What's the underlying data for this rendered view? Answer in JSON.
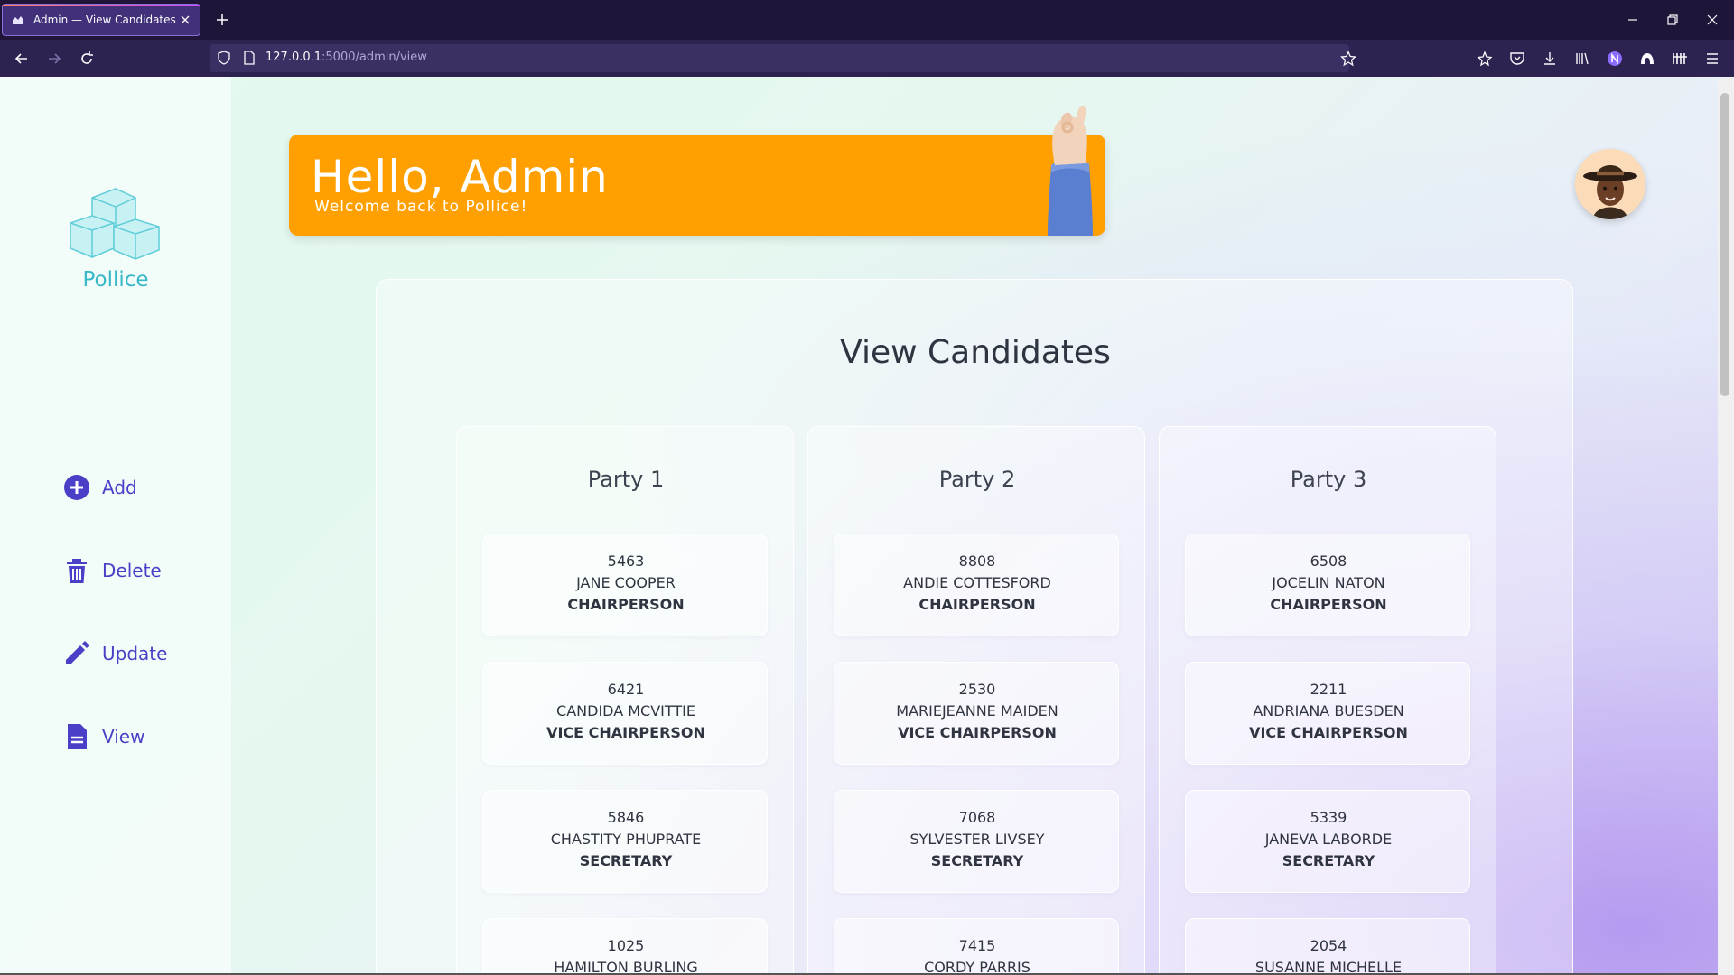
{
  "browser": {
    "tab_title": "Admin — View Candidates",
    "url_host": "127.0.0.1",
    "url_rest": ":5000/admin/view"
  },
  "sidebar": {
    "logo_text": "Pollice",
    "items": [
      {
        "label": "Add",
        "icon": "plus-circle-icon"
      },
      {
        "label": "Delete",
        "icon": "trash-icon"
      },
      {
        "label": "Update",
        "icon": "pencil-icon"
      },
      {
        "label": "View",
        "icon": "document-icon"
      }
    ]
  },
  "banner": {
    "title": "Hello, Admin",
    "subtitle": "Welcome back to Pollice!",
    "color": "#ffa000"
  },
  "main": {
    "title": "View Candidates",
    "parties": [
      {
        "name": "Party 1",
        "candidates": [
          {
            "id": "5463",
            "name": "JANE COOPER",
            "role": "CHAIRPERSON"
          },
          {
            "id": "6421",
            "name": "CANDIDA MCVITTIE",
            "role": "VICE CHAIRPERSON"
          },
          {
            "id": "5846",
            "name": "CHASTITY PHUPRATE",
            "role": "SECRETARY"
          },
          {
            "id": "1025",
            "name": "HAMILTON BURLING",
            "role": ""
          }
        ]
      },
      {
        "name": "Party 2",
        "candidates": [
          {
            "id": "8808",
            "name": "ANDIE COTTESFORD",
            "role": "CHAIRPERSON"
          },
          {
            "id": "2530",
            "name": "MARIEJEANNE MAIDEN",
            "role": "VICE CHAIRPERSON"
          },
          {
            "id": "7068",
            "name": "SYLVESTER LIVSEY",
            "role": "SECRETARY"
          },
          {
            "id": "7415",
            "name": "CORDY PARRIS",
            "role": ""
          }
        ]
      },
      {
        "name": "Party 3",
        "candidates": [
          {
            "id": "6508",
            "name": "JOCELIN NATON",
            "role": "CHAIRPERSON"
          },
          {
            "id": "2211",
            "name": "ANDRIANA BUESDEN",
            "role": "VICE CHAIRPERSON"
          },
          {
            "id": "5339",
            "name": "JANEVA LABORDE",
            "role": "SECRETARY"
          },
          {
            "id": "2054",
            "name": "SUSANNE MICHELLE",
            "role": ""
          }
        ]
      }
    ]
  },
  "colors": {
    "accent": "#4a3fc7",
    "logo": "#39b8c7",
    "banner": "#ffa000"
  }
}
